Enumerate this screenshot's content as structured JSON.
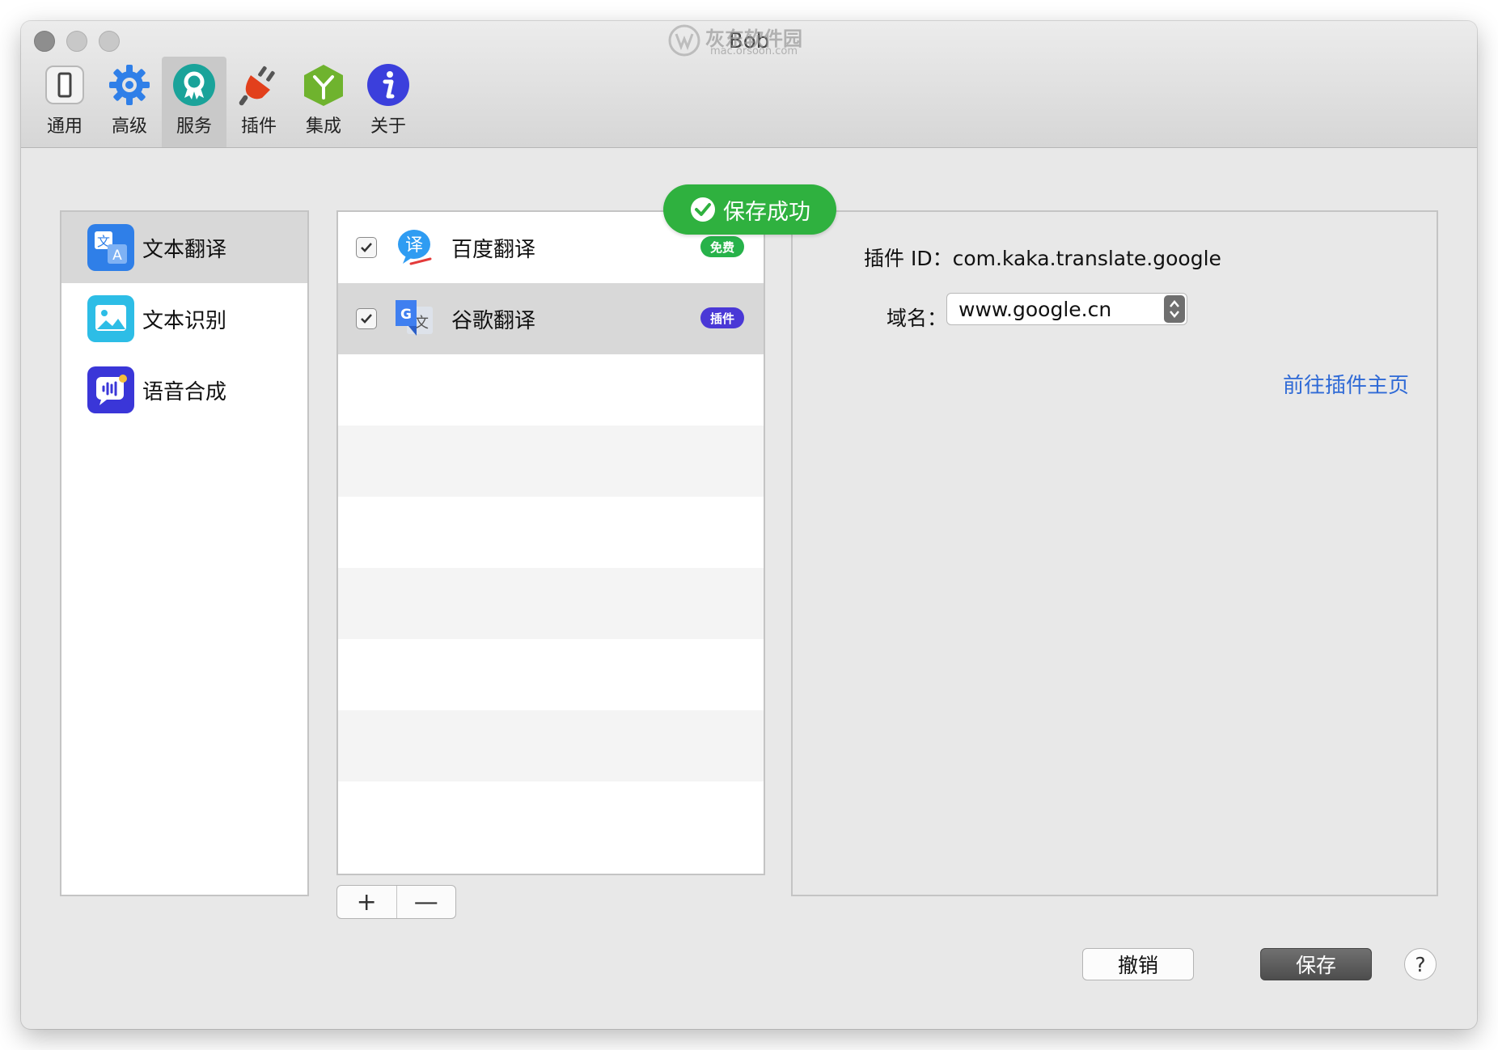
{
  "window": {
    "title": "Bob"
  },
  "watermark": {
    "text": "灰东软件园",
    "sub": "mac.orsoon.com"
  },
  "toolbar": {
    "items": [
      {
        "label": "通用",
        "icon": "switch-icon"
      },
      {
        "label": "高级",
        "icon": "gear-icon"
      },
      {
        "label": "服务",
        "icon": "badge-icon",
        "active": true
      },
      {
        "label": "插件",
        "icon": "plug-icon"
      },
      {
        "label": "集成",
        "icon": "cube-icon"
      },
      {
        "label": "关于",
        "icon": "info-icon"
      }
    ]
  },
  "services": {
    "items": [
      {
        "label": "文本翻译",
        "icon": "translate-icon",
        "selected": true
      },
      {
        "label": "文本识别",
        "icon": "image-scan-icon"
      },
      {
        "label": "语音合成",
        "icon": "voice-icon"
      }
    ]
  },
  "engines": {
    "items": [
      {
        "label": "百度翻译",
        "checked": true,
        "badge": "免费",
        "icon": "baidu-translate-icon"
      },
      {
        "label": "谷歌翻译",
        "checked": true,
        "badge": "插件",
        "icon": "google-translate-icon",
        "selected": true
      }
    ],
    "add_label": "+",
    "remove_label": "—"
  },
  "toast": {
    "label": "保存成功"
  },
  "detail": {
    "plugin_id_text": "插件 ID：com.kaka.translate.google",
    "domain_label": "域名：",
    "domain_value": "www.google.cn",
    "plugin_link": "前往插件主页"
  },
  "footer": {
    "cancel_label": "撤销",
    "save_label": "保存",
    "help_label": "?"
  },
  "colors": {
    "accent_green": "#2fb13f",
    "badge_free": "#27b24a",
    "badge_plugin": "#4a38d6",
    "link": "#2f6ad6"
  }
}
